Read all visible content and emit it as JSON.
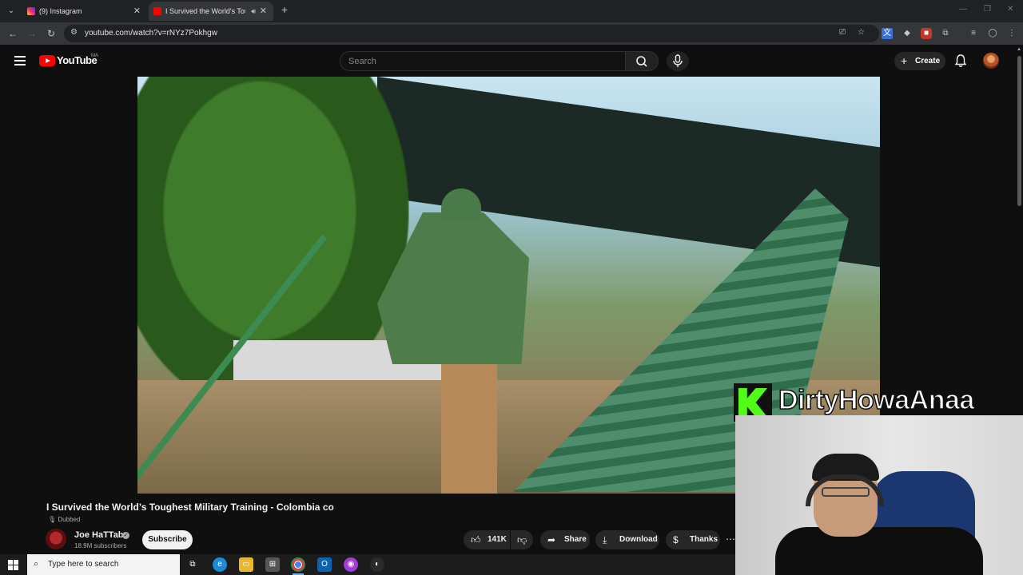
{
  "browser": {
    "tabs": [
      {
        "title": "(9) Instagram",
        "active": false
      },
      {
        "title": "I Survived the World's Toug",
        "active": true
      }
    ],
    "url": "youtube.com/watch?v=rNYz7Pokhgw"
  },
  "youtube": {
    "logo_text": "YouTube",
    "country_code": "MA",
    "search_placeholder": "Search",
    "create_label": "Create"
  },
  "overlay": {
    "streamer_name": "DirtyHowaAnaa"
  },
  "video": {
    "title": "I Survived the World’s Toughest Military Training - Colombia co",
    "dubbed_label": "Dubbed",
    "channel_name": "Joe HaTTab",
    "subscribers": "18.9M subscribers",
    "subscribe_label": "Subscribe",
    "likes": "141K",
    "share_label": "Share",
    "download_label": "Download",
    "thanks_label": "Thanks"
  },
  "taskbar": {
    "search_placeholder": "Type here to search"
  },
  "colors": {
    "brand_red": "#ff0000",
    "kick_green": "#53fc18",
    "background": "#0f0f0f"
  }
}
